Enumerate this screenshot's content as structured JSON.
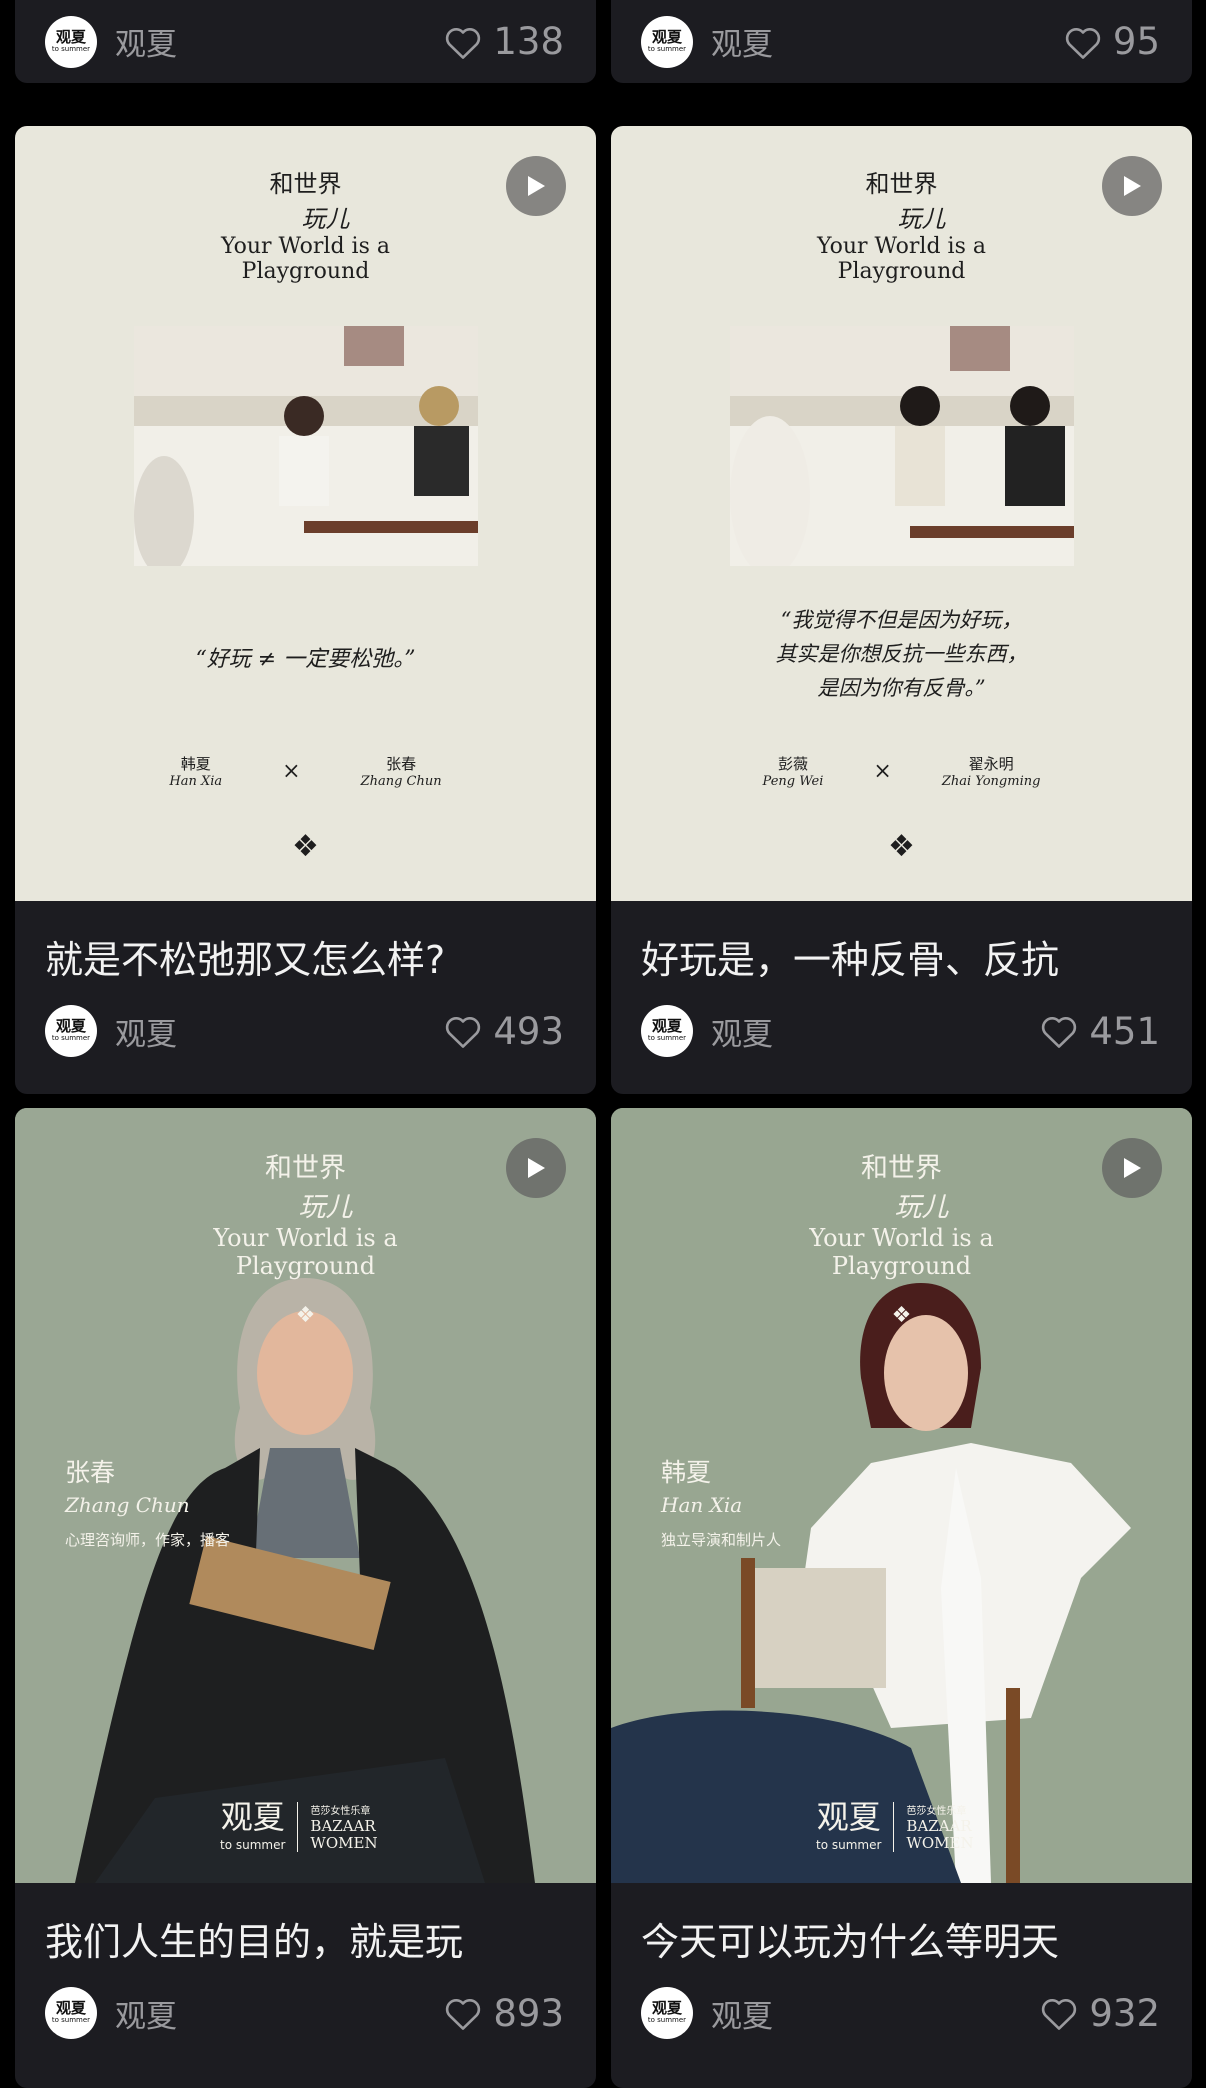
{
  "author": {
    "name": "观夏",
    "logo_main": "观夏",
    "logo_sub": "to summer"
  },
  "cards": [
    {
      "title": "",
      "likes": "138"
    },
    {
      "title": "",
      "likes": "95"
    },
    {
      "title": "就是不松弛那又怎么样?",
      "likes": "493",
      "poster": {
        "heading_cn_1": "和世界",
        "heading_cn_2": "玩儿",
        "heading_en_1": "Your World is a",
        "heading_en_2": "Playground",
        "quote": "“好玩 ≠ 一定要松弛。”",
        "guest_a_cn": "韩夏",
        "guest_a_en": "Han Xia",
        "guest_b_cn": "张春",
        "guest_b_en": "Zhang Chun",
        "times": "×",
        "ornament": "❖"
      }
    },
    {
      "title": "好玩是，一种反骨、反抗",
      "likes": "451",
      "poster": {
        "heading_cn_1": "和世界",
        "heading_cn_2": "玩儿",
        "heading_en_1": "Your World is a",
        "heading_en_2": "Playground",
        "quote_1": "“我觉得不但是因为好玩，",
        "quote_2": "其实是你想反抗一些东西，",
        "quote_3": "是因为你有反骨。”",
        "guest_a_cn": "彭薇",
        "guest_a_en": "Peng Wei",
        "guest_b_cn": "翟永明",
        "guest_b_en": "Zhai Yongming",
        "times": "×",
        "ornament": "❖"
      }
    },
    {
      "title": "我们人生的目的，就是玩",
      "likes": "893",
      "poster": {
        "heading_cn_1": "和世界",
        "heading_cn_2": "玩儿",
        "heading_en_1": "Your World is a",
        "heading_en_2": "Playground",
        "ornament": "❖",
        "person_cn": "张春",
        "person_en": "Zhang Chun",
        "person_role": "心理咨询师，作家，播客",
        "brand_cn": "观夏",
        "brand_en": "to summer",
        "partner_1": "芭莎女性乐章",
        "partner_2": "BAZAAR",
        "partner_3": "WOMEN"
      }
    },
    {
      "title": "今天可以玩为什么等明天",
      "likes": "932",
      "poster": {
        "heading_cn_1": "和世界",
        "heading_cn_2": "玩儿",
        "heading_en_1": "Your World is a",
        "heading_en_2": "Playground",
        "ornament": "❖",
        "person_cn": "韩夏",
        "person_en": "Han Xia",
        "person_role": "独立导演和制片人",
        "brand_cn": "观夏",
        "brand_en": "to summer",
        "partner_1": "芭莎女性乐章",
        "partner_2": "BAZAAR",
        "partner_3": "WOMEN"
      }
    }
  ],
  "colors": {
    "card_bg": "#1c1c21",
    "text_primary": "#f2f2f2",
    "text_muted": "#9a9a9e",
    "paper": "#e8e7dc",
    "sage": "#97a590"
  },
  "icons": {
    "like": "heart-outline-icon",
    "play": "play-icon"
  }
}
